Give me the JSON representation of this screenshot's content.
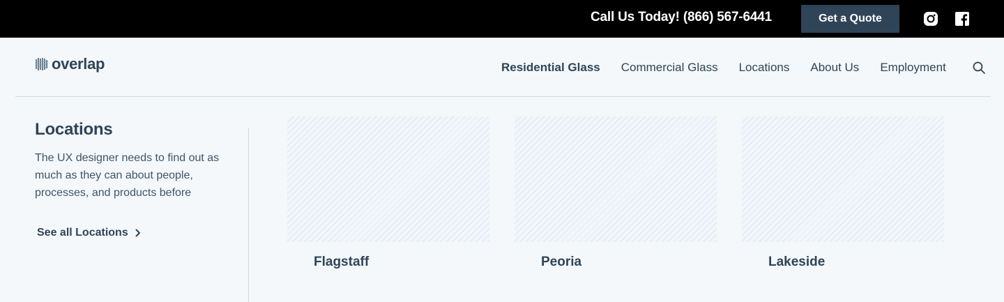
{
  "topbar": {
    "phone_text": "Call Us Today! (866) 567-6441",
    "quote_label": "Get a Quote",
    "social": [
      "instagram-icon",
      "facebook-icon"
    ]
  },
  "header": {
    "logo_text": "overlap",
    "nav": [
      {
        "label": "Residential Glass",
        "active": true
      },
      {
        "label": "Commercial Glass",
        "active": false
      },
      {
        "label": "Locations",
        "active": false
      },
      {
        "label": "About Us",
        "active": false
      },
      {
        "label": "Employment",
        "active": false
      }
    ],
    "search_icon": "search-icon"
  },
  "sidebar": {
    "title": "Locations",
    "description": "The UX designer needs to find out as much as they can about people, processes, and products before",
    "see_all_label": "See all Locations"
  },
  "locations": [
    {
      "name": "Flagstaff"
    },
    {
      "name": "Peoria"
    },
    {
      "name": "Lakeside"
    }
  ],
  "colors": {
    "topbar_bg": "#000000",
    "accent": "#2f4457",
    "page_bg": "#f4f8fb",
    "divider": "#d3d9de"
  }
}
